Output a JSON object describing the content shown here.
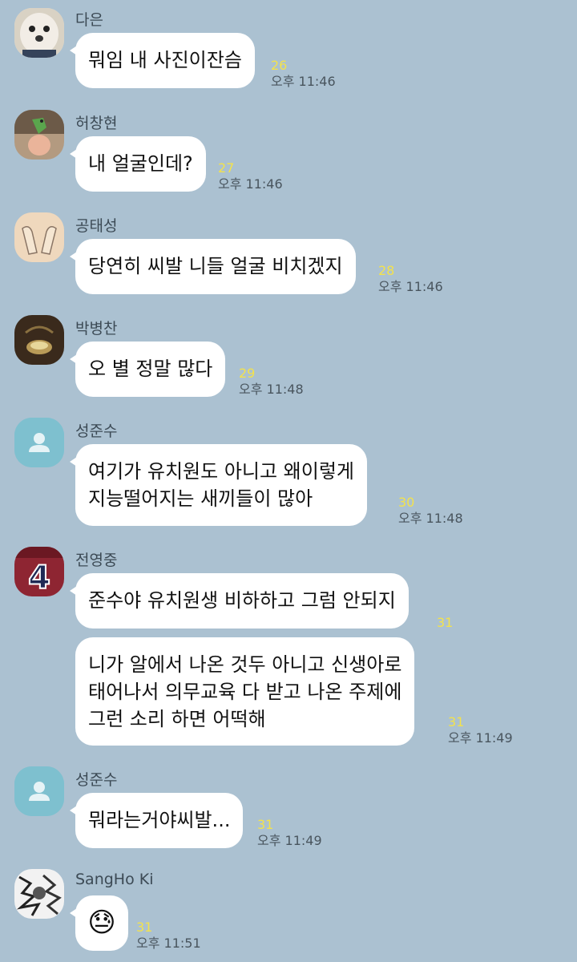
{
  "messages": [
    {
      "name": "다은",
      "avatar_icon": "puppy-photo-icon",
      "bubbles": [
        {
          "text": "뭐임 내 사진이잔슴",
          "count": "26",
          "time": "오후 11:46"
        }
      ]
    },
    {
      "name": "허창현",
      "avatar_icon": "dinosaur-toy-photo-icon",
      "bubbles": [
        {
          "text": "내 얼굴인데?",
          "count": "27",
          "time": "오후 11:46"
        }
      ]
    },
    {
      "name": "공태성",
      "avatar_icon": "feet-sketch-icon",
      "bubbles": [
        {
          "text": "당연히 씨발 니들 얼굴 비치겠지",
          "count": "28",
          "time": "오후 11:46"
        }
      ]
    },
    {
      "name": "박병찬",
      "avatar_icon": "cup-photo-icon",
      "bubbles": [
        {
          "text": "오 별 정말 많다",
          "count": "29",
          "time": "오후 11:48"
        }
      ]
    },
    {
      "name": "성준수",
      "avatar_icon": "default-profile-icon",
      "bubbles": [
        {
          "lines": [
            "여기가 유치원도 아니고 왜이렇게",
            "지능떨어지는 새끼들이 많아"
          ],
          "count": "30",
          "time": "오후 11:48"
        }
      ]
    },
    {
      "name": "전영중",
      "avatar_icon": "jersey-number-4-icon",
      "bubbles": [
        {
          "text": "준수야 유치원생 비하하고 그럼 안되지",
          "count": "31",
          "time": ""
        },
        {
          "lines": [
            "니가 알에서 나온 것두 아니고 신생아로",
            "태어나서 의무교육 다 받고 나온 주제에",
            "그런 소리 하면 어떡해"
          ],
          "count": "31",
          "time": "오후 11:49"
        }
      ]
    },
    {
      "name": "성준수",
      "avatar_icon": "default-profile-icon",
      "bubbles": [
        {
          "text": "뭐라는거야씨발...",
          "count": "31",
          "time": "오후 11:49"
        }
      ]
    },
    {
      "name": "SangHo Ki",
      "avatar_icon": "sketch-portrait-icon",
      "bubbles": [
        {
          "emoji": "😓",
          "emoji_icon": "sweat-face-emoji-icon",
          "count": "31",
          "time": "오후 11:51"
        }
      ]
    }
  ],
  "colors": {
    "background": "#abc1d1",
    "bubble": "#ffffff",
    "unread": "#f3e24c",
    "time": "#49555e"
  }
}
